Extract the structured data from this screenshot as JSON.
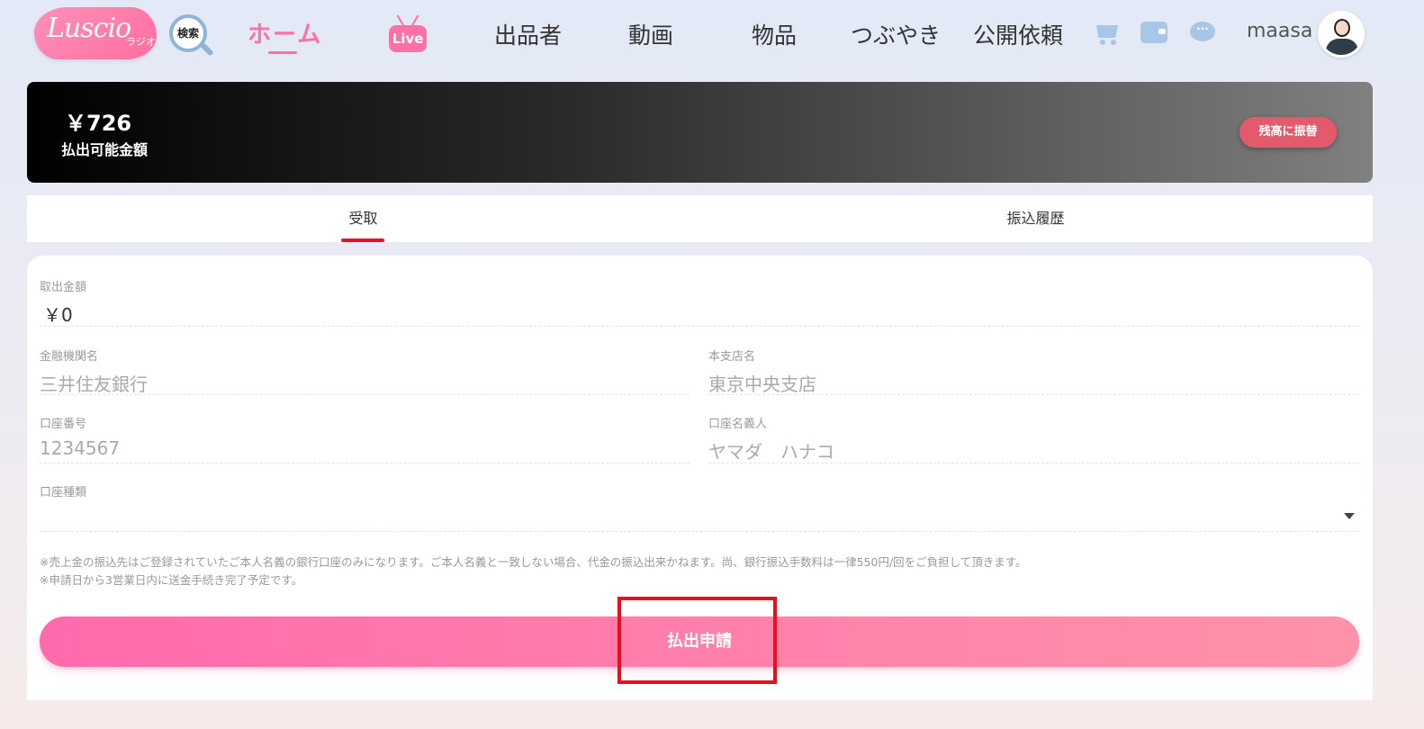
{
  "header": {
    "logo_text": "Luscio",
    "logo_sub": "ラジオ",
    "search_label": "検索",
    "nav": {
      "home": "ホーム",
      "live": "Live",
      "sellers": "出品者",
      "videos": "動画",
      "items": "物品",
      "tweets": "つぶやき",
      "requests": "公開依頼"
    },
    "username": "maasa"
  },
  "balance": {
    "amount": "￥726",
    "label": "払出可能金額",
    "transfer_button": "残高に振替"
  },
  "tabs": [
    {
      "label": "受取",
      "active": true
    },
    {
      "label": "振込履歴",
      "active": false
    }
  ],
  "form": {
    "amount": {
      "label": "取出金額",
      "value": "￥0"
    },
    "bank_name": {
      "label": "金融機関名",
      "placeholder": "三井住友銀行"
    },
    "branch_name": {
      "label": "本支店名",
      "placeholder": "東京中央支店"
    },
    "account_number": {
      "label": "口座番号",
      "placeholder": "1234567"
    },
    "account_holder": {
      "label": "口座名義人",
      "placeholder": "ヤマダ　ハナコ"
    },
    "account_type": {
      "label": "口座種類",
      "value": ""
    },
    "notice_1": "※売上金の振込先はご登録されていたご本人名義の銀行口座のみになります。ご本人名義と一致しない場合、代金の振込出来かねます。尚、銀行振込手数料は一律550円/回をご負担して頂きます。",
    "notice_2": "※申請日から3営業日内に送金手続き完了予定です。",
    "submit_button": "払出申請"
  },
  "colors": {
    "accent_pink": "#ff6fa8",
    "tab_active": "#e8102a",
    "highlight": "#e8101c",
    "icon_blue": "#a8c6e6"
  }
}
